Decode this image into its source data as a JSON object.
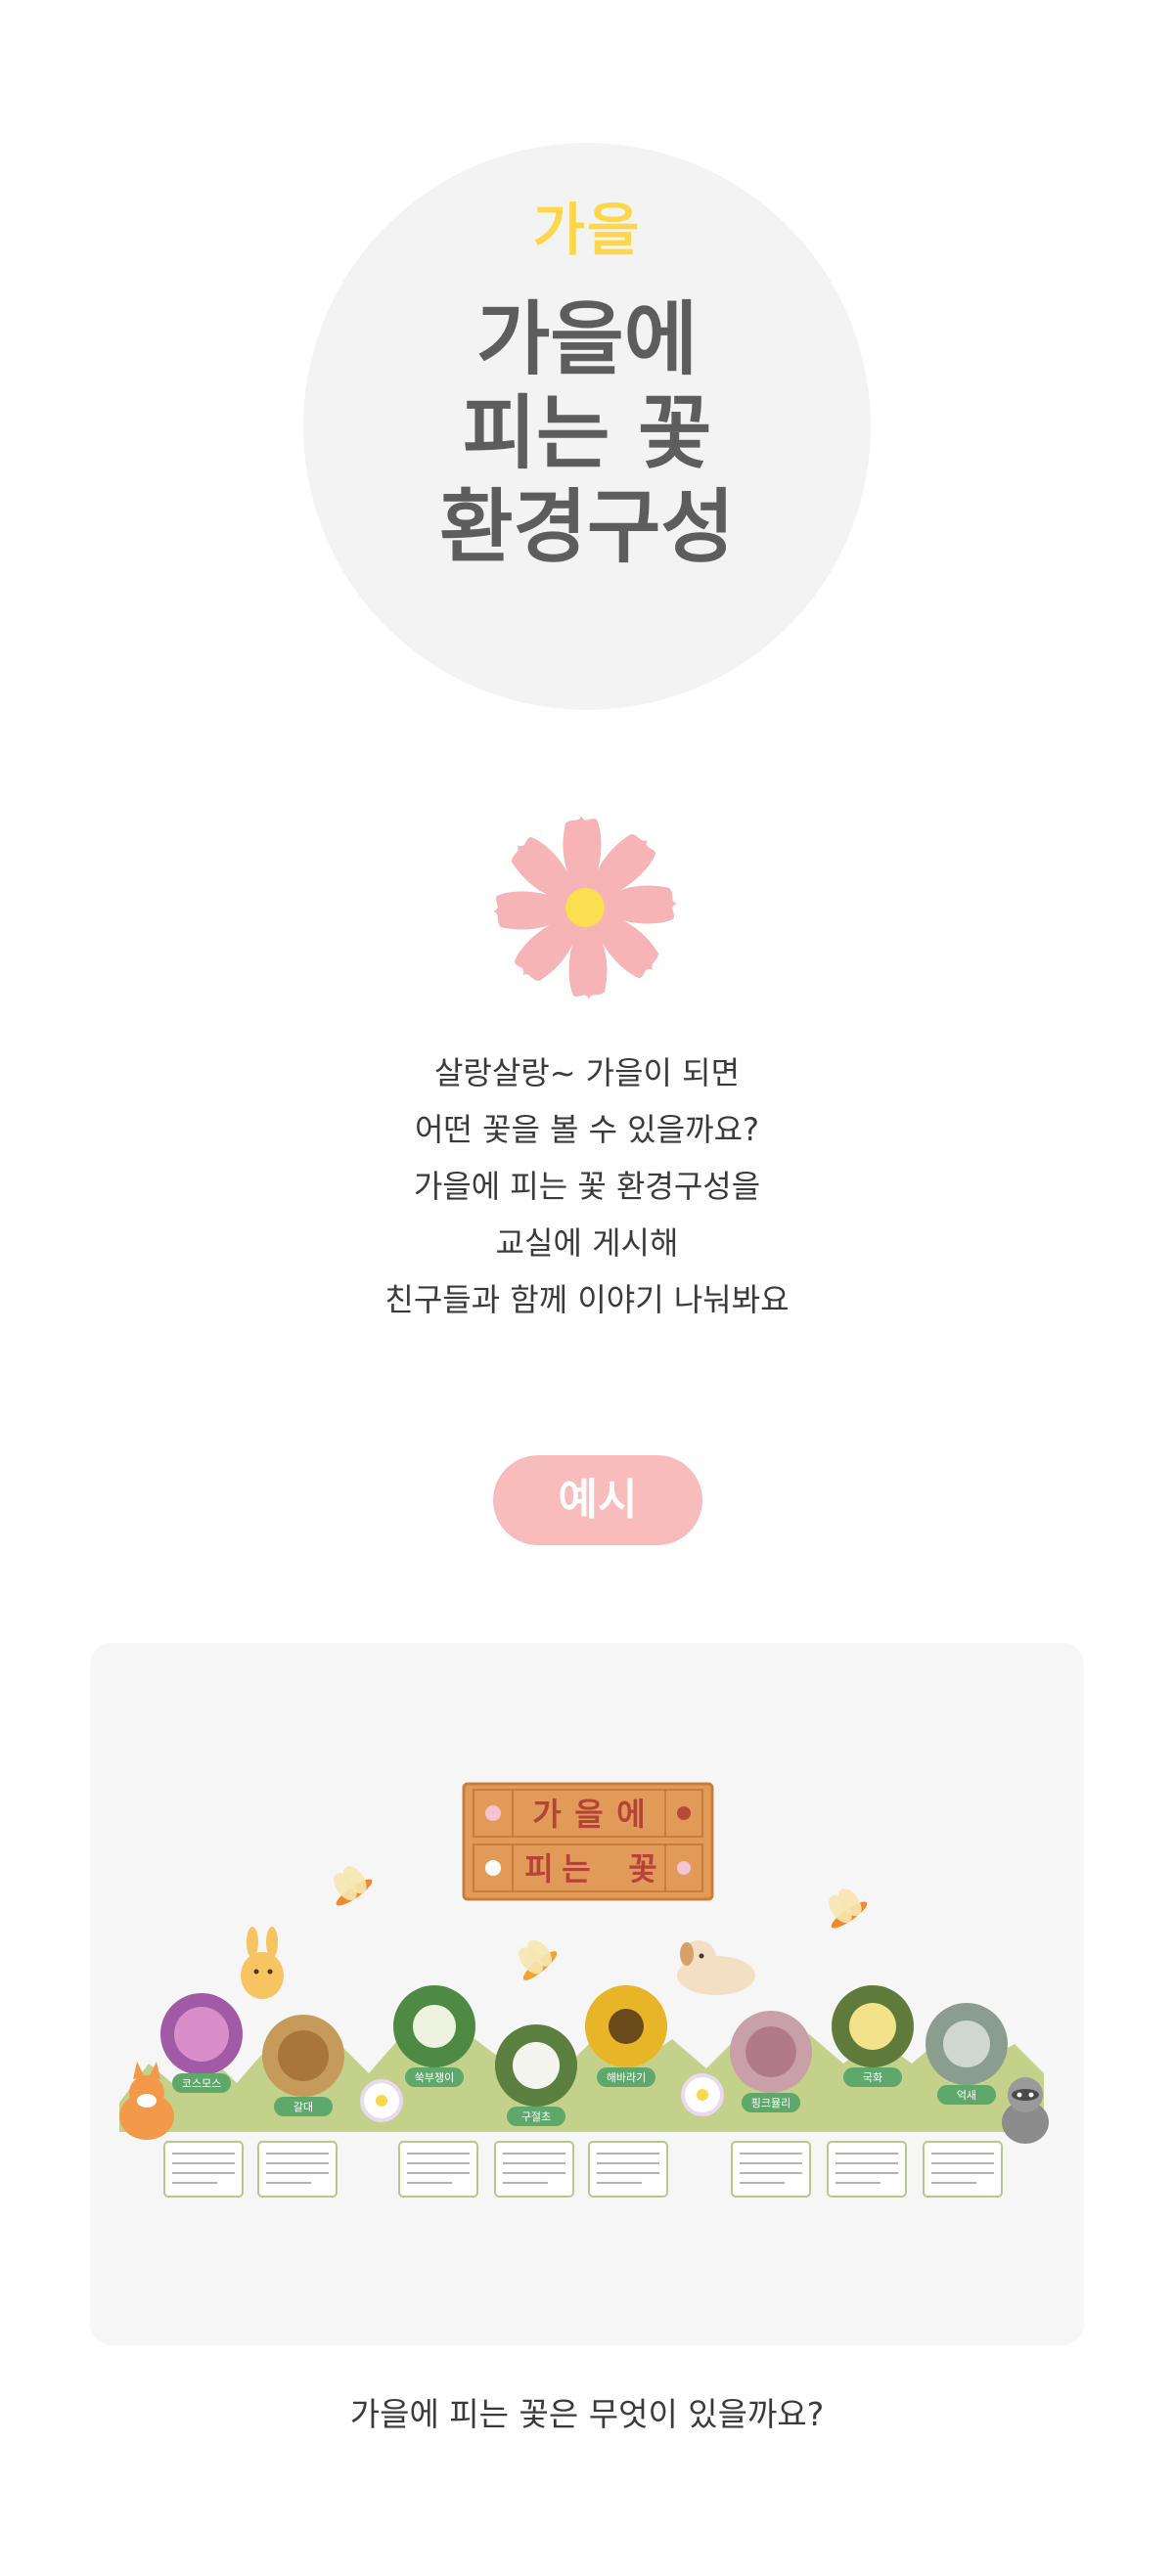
{
  "hero": {
    "season": "가을",
    "title_lines": [
      "가을에",
      "피는 꽃",
      "환경구성"
    ]
  },
  "intro": {
    "lines": [
      "살랑살랑~ 가을이 되면",
      "어떤 꽃을 볼 수 있을까요?",
      "가을에 피는 꽃 환경구성을",
      "교실에 게시해",
      "친구들과 함께 이야기 나눠봐요"
    ]
  },
  "example": {
    "label": "예시",
    "sign_row1": [
      "가",
      "을",
      "에"
    ],
    "sign_row2": [
      "피",
      "는",
      "꽃"
    ],
    "flower_labels": [
      "코스모스",
      "갈대",
      "쑥부쟁이",
      "구절초",
      "해바라기",
      "핑크뮬리",
      "국화",
      "억새"
    ]
  },
  "caption": "가을에 피는 꽃은 무엇이 있을까요?",
  "colors": {
    "accent_yellow": "#fcd74c",
    "title_gray": "#5d5d5d",
    "pink": "#f8bcbd",
    "flower_pink": "#f6b4b6",
    "grass_green": "#c3d18a",
    "label_green": "#5fa86b"
  }
}
